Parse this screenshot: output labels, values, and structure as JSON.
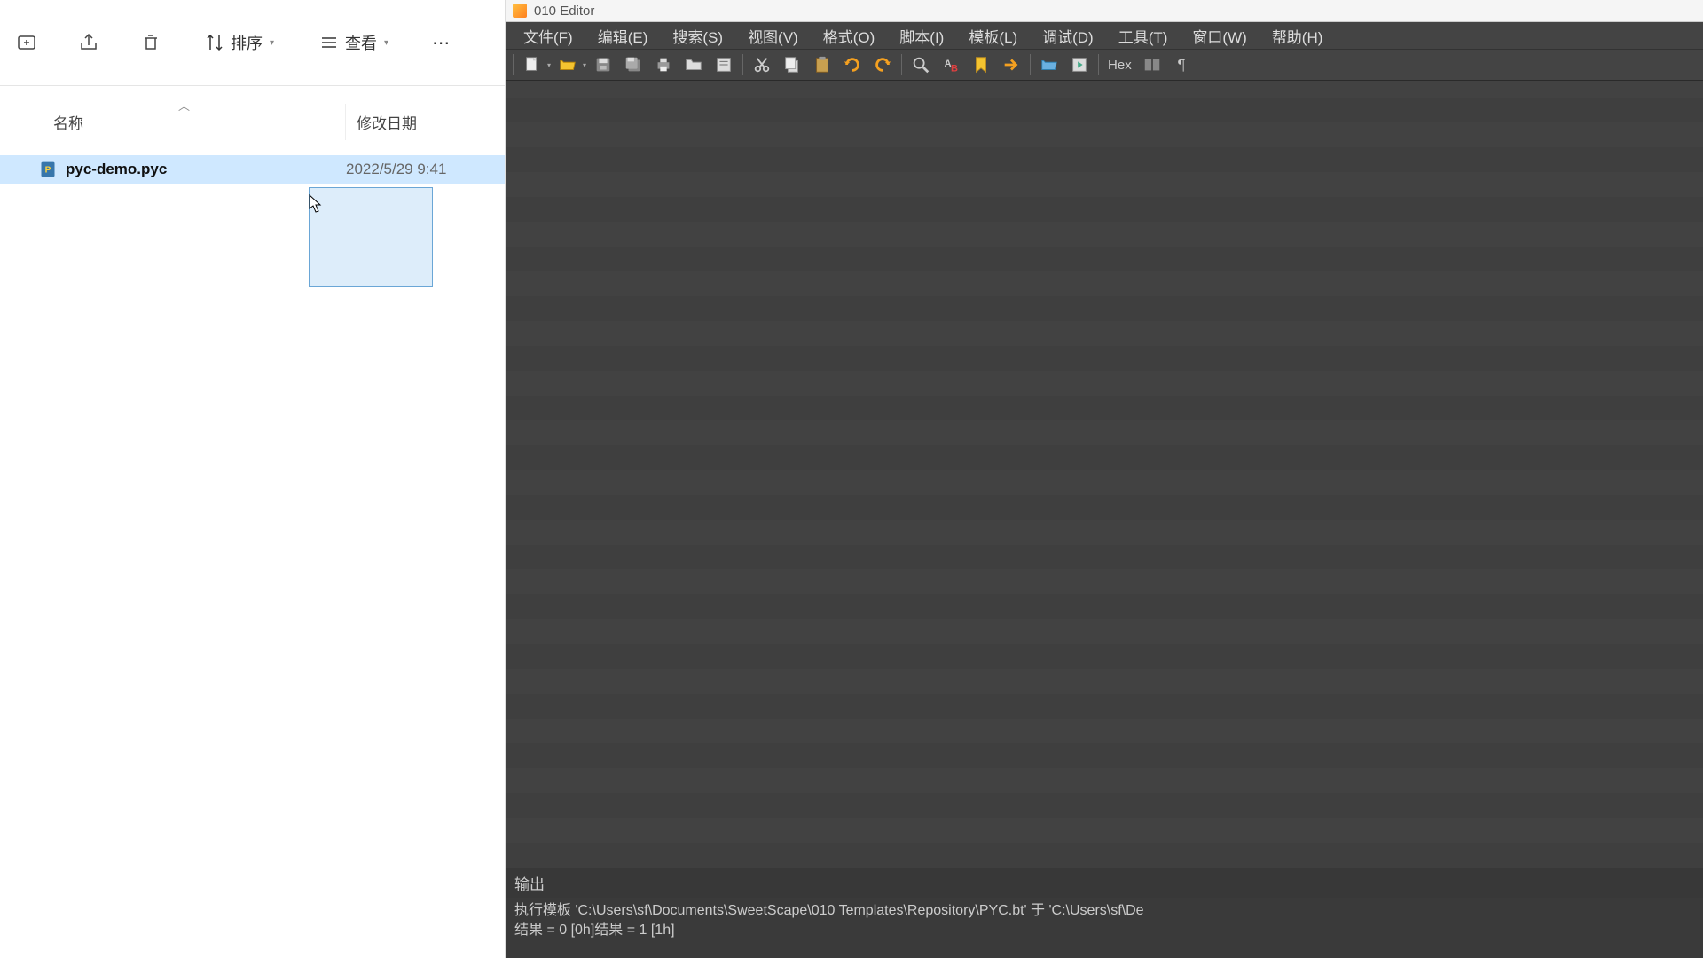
{
  "explorer": {
    "toolbar": {
      "sort_label": "排序",
      "view_label": "查看"
    },
    "columns": {
      "name": "名称",
      "date": "修改日期"
    },
    "files": [
      {
        "name": "pyc-demo.pyc",
        "date": "2022/5/29 9:41"
      }
    ]
  },
  "editor": {
    "title": "010 Editor",
    "menu": {
      "file": "文件(F)",
      "edit": "编辑(E)",
      "search": "搜索(S)",
      "view": "视图(V)",
      "format": "格式(O)",
      "script": "脚本(I)",
      "template": "模板(L)",
      "debug": "调试(D)",
      "tools": "工具(T)",
      "window": "窗口(W)",
      "help": "帮助(H)"
    },
    "toolbar": {
      "hex": "Hex"
    },
    "output": {
      "title": "输出",
      "line1": "执行模板 'C:\\Users\\sf\\Documents\\SweetScape\\010 Templates\\Repository\\PYC.bt' 于 'C:\\Users\\sf\\De",
      "line2": "结果 = 0 [0h]结果 = 1 [1h]"
    }
  }
}
